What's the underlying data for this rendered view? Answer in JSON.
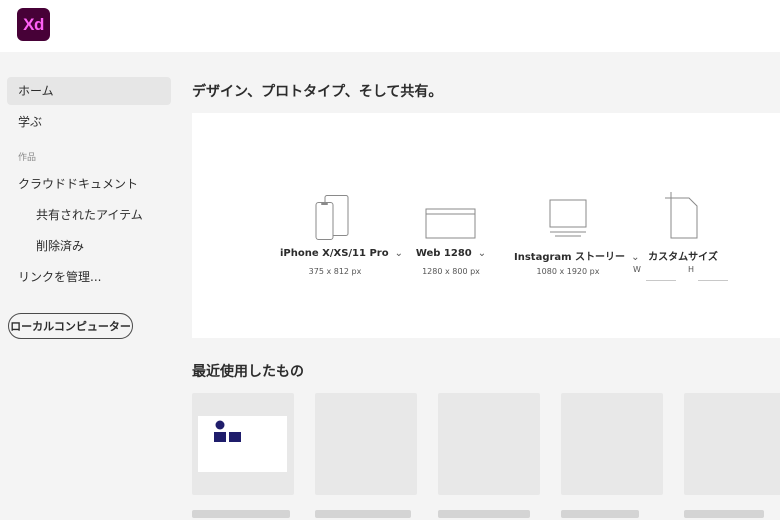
{
  "app": {
    "logo_text": "Xd",
    "logo_bg": "#470137",
    "logo_fg": "#ff61f6"
  },
  "sidebar": {
    "items": [
      {
        "label": "ホーム",
        "active": true
      },
      {
        "label": "学ぶ"
      },
      {
        "label": "クラウドドキュメント"
      },
      {
        "label": "共有されたアイテム"
      },
      {
        "label": "削除済み"
      },
      {
        "label": "リンクを管理..."
      }
    ],
    "section_label": "作品",
    "local_button_label": "ローカルコンピューター"
  },
  "main": {
    "create_title": "デザイン、プロトタイプ、そして共有。",
    "presets": [
      {
        "label": "iPhone X/XS/11 Pro",
        "size": "375 x 812 px",
        "icon": "phone-icon"
      },
      {
        "label": "Web 1280",
        "size": "1280 x 800 px",
        "icon": "browser-icon"
      },
      {
        "label": "Instagram ストーリー",
        "size": "1080 x 1920 px",
        "icon": "monitor-icon"
      },
      {
        "label": "カスタムサイズ",
        "icon": "document-icon",
        "width_label": "W",
        "height_label": "H"
      }
    ],
    "recent_title": "最近使用したもの"
  },
  "colors": {
    "accent_navy": "#1f1d6b"
  }
}
